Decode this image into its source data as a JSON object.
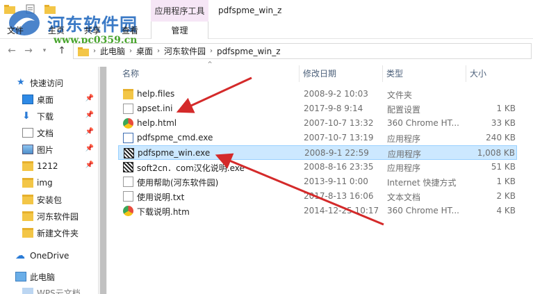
{
  "window": {
    "title": "pdfspme_win_z",
    "context_tab_header": "应用程序工具",
    "context_tab_sub": "管理"
  },
  "ribbon_tabs": [
    "文件",
    "主页",
    "共享",
    "查看"
  ],
  "watermark": {
    "text": "河东软件园",
    "url": "www.pc0359.cn"
  },
  "address_bar": {
    "crumbs": [
      "此电脑",
      "桌面",
      "河东软件园",
      "pdfspme_win_z"
    ]
  },
  "sidebar": {
    "items": [
      {
        "label": "快速访问",
        "icon": "star-icon",
        "pinned": false
      },
      {
        "label": "桌面",
        "icon": "desktop-icon",
        "pinned": true
      },
      {
        "label": "下载",
        "icon": "download-icon",
        "pinned": true
      },
      {
        "label": "文档",
        "icon": "document-icon",
        "pinned": true
      },
      {
        "label": "图片",
        "icon": "picture-icon",
        "pinned": true
      },
      {
        "label": "1212",
        "icon": "folder-icon",
        "pinned": true
      },
      {
        "label": "img",
        "icon": "folder-icon",
        "pinned": false
      },
      {
        "label": "安装包",
        "icon": "folder-icon",
        "pinned": false
      },
      {
        "label": "河东软件园",
        "icon": "folder-icon",
        "pinned": false
      },
      {
        "label": "新建文件夹",
        "icon": "folder-icon",
        "pinned": false
      },
      {
        "label": "OneDrive",
        "icon": "cloud-icon",
        "pinned": false
      },
      {
        "label": "此电脑",
        "icon": "computer-icon",
        "pinned": false
      },
      {
        "label": "WPS云文档",
        "icon": "wps-cloud-icon",
        "pinned": false
      }
    ]
  },
  "columns": {
    "name": "名称",
    "date": "修改日期",
    "type": "类型",
    "size": "大小"
  },
  "files": [
    {
      "name": "help.files",
      "date": "2008-9-2 10:03",
      "type": "文件夹",
      "size": "",
      "icon": "folder-icon"
    },
    {
      "name": "apset.ini",
      "date": "2017-9-8 9:14",
      "type": "配置设置",
      "size": "1 KB",
      "icon": "settings-file-icon"
    },
    {
      "name": "help.html",
      "date": "2007-10-7 13:32",
      "type": "360 Chrome HT...",
      "size": "33 KB",
      "icon": "chrome-icon"
    },
    {
      "name": "pdfspme_cmd.exe",
      "date": "2007-10-7 13:19",
      "type": "应用程序",
      "size": "240 KB",
      "icon": "exe-icon"
    },
    {
      "name": "pdfspme_win.exe",
      "date": "2008-9-1 22:59",
      "type": "应用程序",
      "size": "1,008 KB",
      "icon": "app-icon"
    },
    {
      "name": "soft2cn．com汉化说明.exe",
      "date": "2008-8-16 23:35",
      "type": "应用程序",
      "size": "51 KB",
      "icon": "app-icon"
    },
    {
      "name": "使用帮助(河东软件园)",
      "date": "2013-9-11 0:00",
      "type": "Internet 快捷方式",
      "size": "1 KB",
      "icon": "shortcut-icon"
    },
    {
      "name": "使用说明.txt",
      "date": "2017-8-13 16:06",
      "type": "文本文档",
      "size": "2 KB",
      "icon": "text-file-icon"
    },
    {
      "name": "下载说明.htm",
      "date": "2014-12-25 10:17",
      "type": "360 Chrome HT...",
      "size": "4 KB",
      "icon": "chrome-icon"
    }
  ],
  "selected_row": 4,
  "colors": {
    "selection_bg": "#cce8ff",
    "selection_border": "#99d1ff",
    "context_tab": "#f6e6f6",
    "annotation_arrow": "#d42a2a"
  }
}
